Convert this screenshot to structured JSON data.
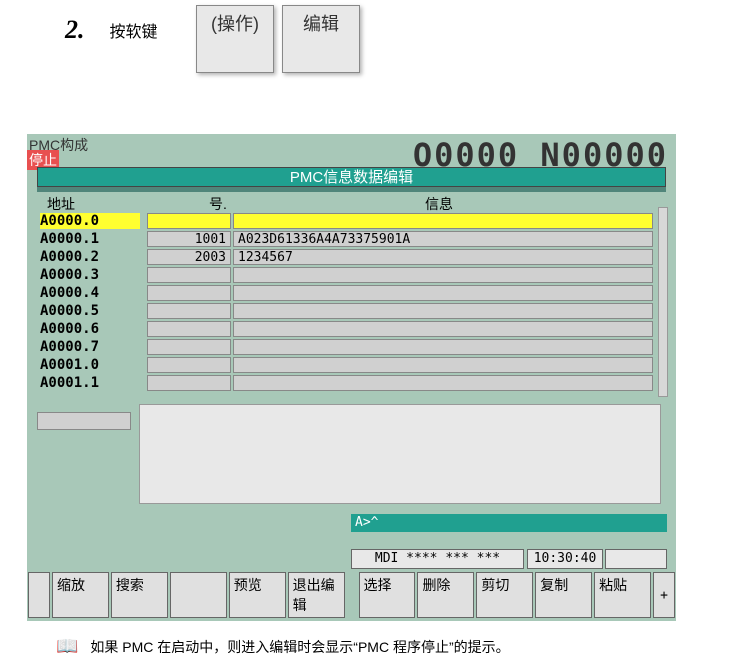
{
  "step": {
    "num": "2.",
    "text": "按软键",
    "btn1": "(操作)",
    "btn2": "编辑"
  },
  "screen": {
    "head1": "PMC构成",
    "head2": "停止",
    "id": "O0000 N00000",
    "title": "PMC信息数据编辑",
    "headers": {
      "addr": "地址",
      "num": "号.",
      "info": "信息"
    },
    "rows": [
      {
        "addr": "A0000.0",
        "num": "",
        "info": "",
        "sel": true
      },
      {
        "addr": "A0000.1",
        "num": "1001",
        "info": "A023D61336A4A73375901A",
        "sel": false
      },
      {
        "addr": "A0000.2",
        "num": "2003",
        "info": " 1234567",
        "sel": false
      },
      {
        "addr": "A0000.3",
        "num": "",
        "info": "",
        "sel": false
      },
      {
        "addr": "A0000.4",
        "num": "",
        "info": "",
        "sel": false
      },
      {
        "addr": "A0000.5",
        "num": "",
        "info": "",
        "sel": false
      },
      {
        "addr": "A0000.6",
        "num": "",
        "info": "",
        "sel": false
      },
      {
        "addr": "A0000.7",
        "num": "",
        "info": "",
        "sel": false
      },
      {
        "addr": "A0001.0",
        "num": "",
        "info": "",
        "sel": false
      },
      {
        "addr": "A0001.1",
        "num": "",
        "info": "",
        "sel": false
      }
    ],
    "prompt": "A>^",
    "status_mode": "MDI  **** *** ***",
    "status_time": "10:30:40",
    "softkeys_left_arrow": "",
    "softkeys": [
      "缩放",
      "搜索",
      "",
      "预览",
      "退出编辑",
      "选择",
      "删除",
      "剪切",
      "复制",
      "粘贴"
    ],
    "softkeys_right_arrow": "+"
  },
  "note": {
    "icon": "📖",
    "text": "如果 PMC 在启动中，则进入编辑时会显示“PMC 程序停止”的提示。"
  }
}
